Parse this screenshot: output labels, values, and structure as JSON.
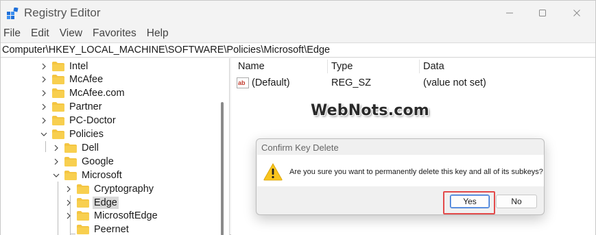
{
  "window": {
    "title": "Registry Editor"
  },
  "menu": [
    "File",
    "Edit",
    "View",
    "Favorites",
    "Help"
  ],
  "address": "Computer\\HKEY_LOCAL_MACHINE\\SOFTWARE\\Policies\\Microsoft\\Edge",
  "tree": {
    "items": [
      {
        "label": "Intel",
        "expanded": false,
        "selected": false
      },
      {
        "label": "McAfee",
        "expanded": false,
        "selected": false
      },
      {
        "label": "McAfee.com",
        "expanded": false,
        "selected": false
      },
      {
        "label": "Partner",
        "expanded": false,
        "selected": false
      },
      {
        "label": "PC-Doctor",
        "expanded": false,
        "selected": false
      },
      {
        "label": "Policies",
        "expanded": true,
        "selected": false
      },
      {
        "label": "Dell",
        "expanded": false,
        "selected": false
      },
      {
        "label": "Google",
        "expanded": false,
        "selected": false
      },
      {
        "label": "Microsoft",
        "expanded": true,
        "selected": false
      },
      {
        "label": "Cryptography",
        "expanded": false,
        "selected": false
      },
      {
        "label": "Edge",
        "expanded": false,
        "selected": true
      },
      {
        "label": "MicrosoftEdge",
        "expanded": false,
        "selected": false
      },
      {
        "label": "Peernet",
        "expanded": false,
        "selected": false
      }
    ]
  },
  "list": {
    "headers": {
      "name": "Name",
      "type": "Type",
      "data": "Data"
    },
    "rows": [
      {
        "name": "(Default)",
        "type": "REG_SZ",
        "data": "(value not set)",
        "icon": "string-value-icon"
      }
    ]
  },
  "watermark": "WebNots.com",
  "dialog": {
    "title": "Confirm Key Delete",
    "message": "Are you sure you want to permanently delete this key and all of its subkeys?",
    "yes_label": "Yes",
    "no_label": "No",
    "icon": "warning-icon"
  },
  "colors": {
    "folder": "#f4c542",
    "highlight": "#e34a4a",
    "selection": "#d9d9d9",
    "focus": "#2c6fd1"
  }
}
